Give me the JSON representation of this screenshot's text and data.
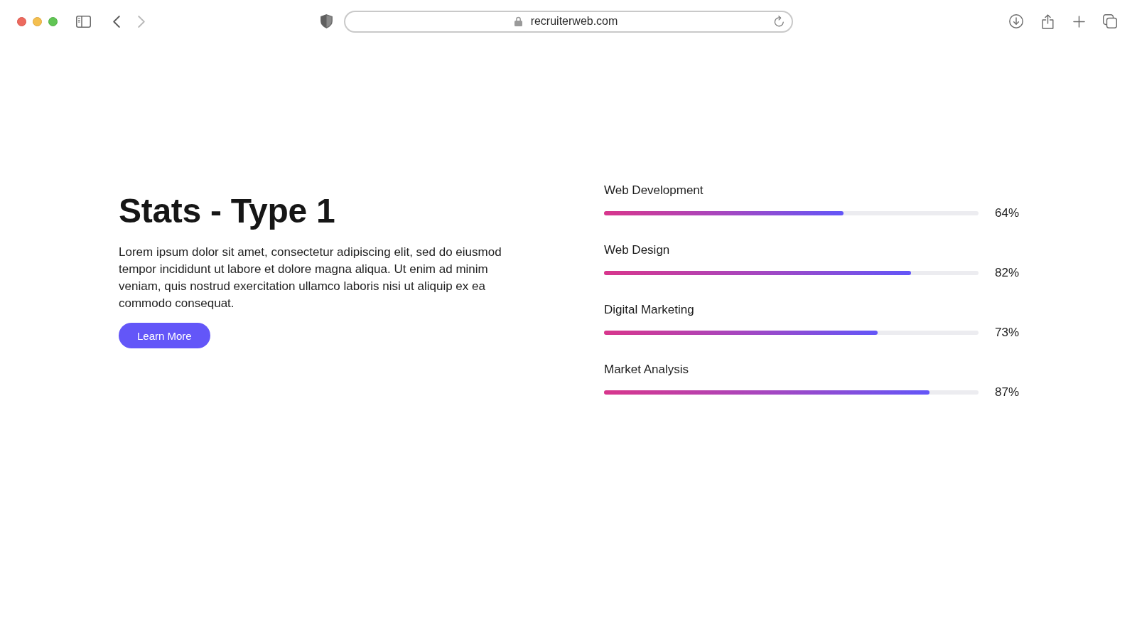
{
  "browser": {
    "back": {
      "disabled": false
    },
    "forward": {
      "disabled": true
    },
    "url": "recruiterweb.com"
  },
  "hero": {
    "title": "Stats - Type 1",
    "text": "Lorem ipsum dolor sit amet, consectetur adipiscing elit, sed do eiusmod tempor incididunt ut labore et dolore magna aliqua. Ut enim ad minim veniam, quis nostrud exercitation ullamco laboris nisi ut aliquip ex ea commodo consequat.",
    "button": "Learn More"
  },
  "stats": [
    {
      "label": "Web Development",
      "level": 0.64,
      "reading": "64%"
    },
    {
      "label": "Web Design",
      "level": 0.82,
      "reading": "82%"
    },
    {
      "label": "Digital Marketing",
      "level": 0.73,
      "reading": "73%"
    },
    {
      "label": "Market Analysis",
      "level": 0.87,
      "reading": "87%"
    }
  ]
}
